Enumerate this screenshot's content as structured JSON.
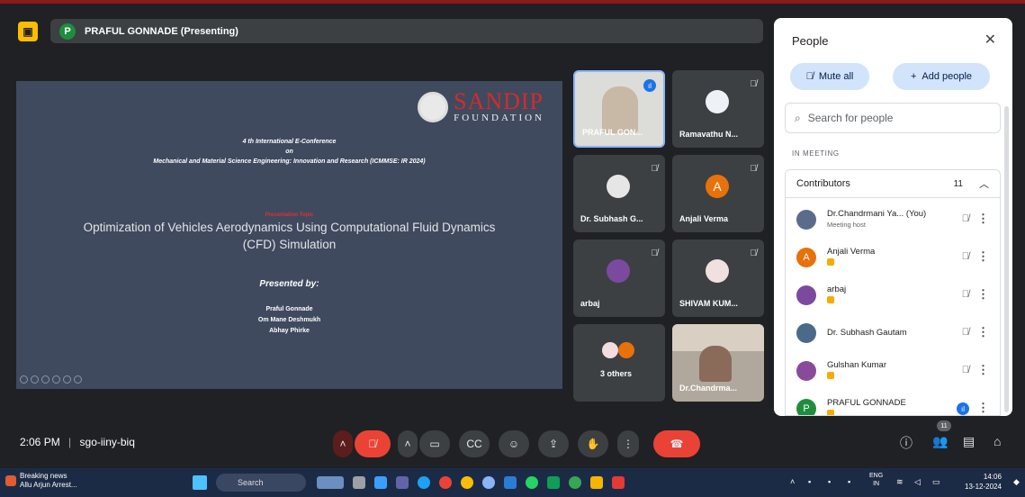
{
  "presenter": {
    "initial": "P",
    "label": "PRAFUL GONNADE (Presenting)"
  },
  "slide": {
    "logo_name": "SANDIP",
    "logo_sub": "FOUNDATION",
    "conference_line1": "4 th International E-Conference",
    "conference_line2": "on",
    "conference_line3": "Mechanical and Material Science Engineering: Innovation and Research (ICMMSE: IR 2024)",
    "section_label": "Presentation Topic",
    "title": "Optimization of Vehicles Aerodynamics Using Computational Fluid Dynamics (CFD) Simulation",
    "presented_by": "Presented by:",
    "authors": [
      "Praful Gonnade",
      "Om Mane Deshmukh",
      "Abhay Phirke"
    ]
  },
  "tiles": [
    {
      "name": "PRAFUL GON...",
      "kind": "camera-selected"
    },
    {
      "name": "Ramavathu N...",
      "kind": "avatar"
    },
    {
      "name": "Dr. Subhash G...",
      "kind": "avatar"
    },
    {
      "name": "Anjali Verma",
      "kind": "letter",
      "initial": "A",
      "color": "#e8710a"
    },
    {
      "name": "arbaj",
      "kind": "avatar"
    },
    {
      "name": "SHIVAM KUM...",
      "kind": "avatar"
    },
    {
      "name": "3 others",
      "kind": "group"
    },
    {
      "name": "Dr.Chandrma...",
      "kind": "camera"
    }
  ],
  "people_panel": {
    "title": "People",
    "mute_all": "Mute all",
    "add_people": "Add people",
    "search_placeholder": "Search for people",
    "section": "IN MEETING",
    "group_label": "Contributors",
    "group_count": "11",
    "people": [
      {
        "name": "Dr.Chandrmani Ya... (You)",
        "sub": "Meeting host",
        "color": "#5a6b8c"
      },
      {
        "name": "Anjali Verma",
        "initial": "A",
        "color": "#e8710a",
        "hand": true
      },
      {
        "name": "arbaj",
        "color": "#7b4a9e",
        "hand": true
      },
      {
        "name": "Dr. Subhash Gautam",
        "color": "#4a6a8a"
      },
      {
        "name": "Gulshan Kumar",
        "color": "#8a4a9a",
        "hand": true
      },
      {
        "name": "PRAFUL GONNADE",
        "initial": "P",
        "color": "#1e8e3e",
        "hand": true
      }
    ]
  },
  "bottom_bar": {
    "time": "2:06 PM",
    "separator": "|",
    "meeting_code": "sgo-iiny-biq",
    "participants_badge": "11"
  },
  "taskbar": {
    "news_title": "Breaking news",
    "news_sub": "Allu Arjun Arrest...",
    "search": "Search",
    "lang_top": "ENG",
    "lang_bottom": "IN",
    "clock_time": "14:06",
    "clock_date": "13-12-2024"
  }
}
